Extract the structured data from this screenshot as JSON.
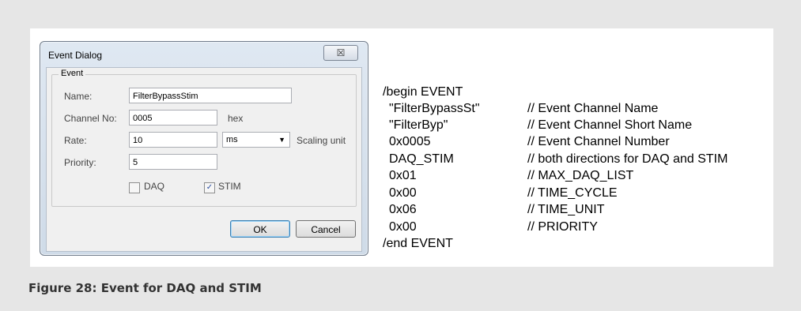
{
  "dialog": {
    "title": "Event Dialog",
    "close_label": "☒",
    "group_label": "Event",
    "name_label": "Name:",
    "name_value": "FilterBypassStim",
    "channel_label": "Channel No:",
    "channel_value": "0005",
    "channel_unit": "hex",
    "rate_label": "Rate:",
    "rate_value": "10",
    "rate_unit_selected": "ms",
    "scaling_label": "Scaling unit",
    "priority_label": "Priority:",
    "priority_value": "5",
    "daq_label": "DAQ",
    "daq_checked": false,
    "stim_label": "STIM",
    "stim_checked": true,
    "ok_label": "OK",
    "cancel_label": "Cancel"
  },
  "code": {
    "begin": "/begin EVENT",
    "lines": [
      {
        "value": "\"FilterBypassSt\"",
        "comment": "// Event Channel Name"
      },
      {
        "value": "\"FilterByp\"",
        "comment": "// Event Channel Short Name"
      },
      {
        "value": "0x0005",
        "comment": "// Event Channel Number"
      },
      {
        "value": "DAQ_STIM",
        "comment": "// both directions for DAQ and STIM"
      },
      {
        "value": "0x01",
        "comment": "// MAX_DAQ_LIST"
      },
      {
        "value": "0x00",
        "comment": "// TIME_CYCLE"
      },
      {
        "value": "0x06",
        "comment": "// TIME_UNIT"
      },
      {
        "value": "0x00",
        "comment": "// PRIORITY"
      }
    ],
    "end": "/end EVENT"
  },
  "caption": "Figure 28: Event for DAQ and STIM"
}
